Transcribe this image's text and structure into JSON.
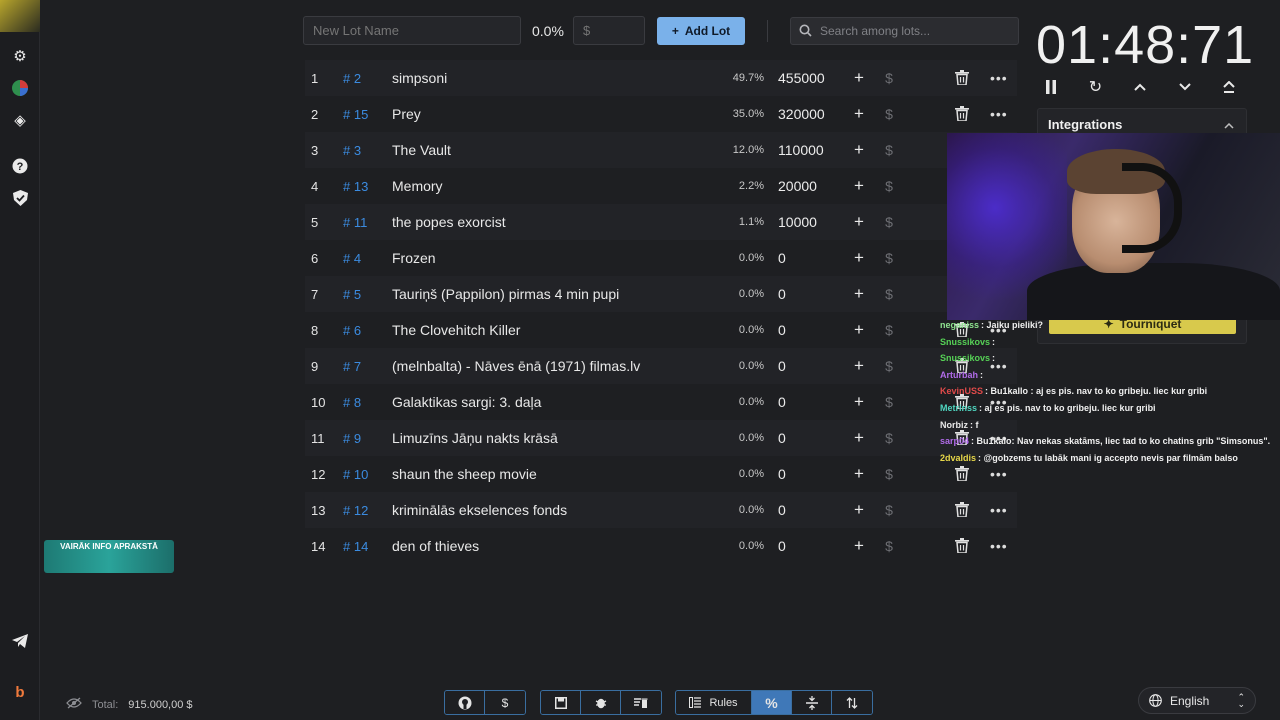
{
  "toolbar": {
    "lot_name_placeholder": "New Lot Name",
    "percent_value": "0.0%",
    "amount_placeholder": "$",
    "add_lot_label": "Add Lot",
    "search_placeholder": "Search among lots..."
  },
  "lots": [
    {
      "index": "1",
      "id": "# 2",
      "name": "simpsoni",
      "percent": "49.7%",
      "amount": "455000"
    },
    {
      "index": "2",
      "id": "# 15",
      "name": "Prey",
      "percent": "35.0%",
      "amount": "320000"
    },
    {
      "index": "3",
      "id": "# 3",
      "name": "The Vault",
      "percent": "12.0%",
      "amount": "110000"
    },
    {
      "index": "4",
      "id": "# 13",
      "name": "Memory",
      "percent": "2.2%",
      "amount": "20000"
    },
    {
      "index": "5",
      "id": "# 11",
      "name": "the popes exorcist",
      "percent": "1.1%",
      "amount": "10000"
    },
    {
      "index": "6",
      "id": "# 4",
      "name": "Frozen",
      "percent": "0.0%",
      "amount": "0"
    },
    {
      "index": "7",
      "id": "# 5",
      "name": "Tauriņš (Pappilon) pirmas 4 min pupi",
      "percent": "0.0%",
      "amount": "0"
    },
    {
      "index": "8",
      "id": "# 6",
      "name": "The Clovehitch Killer",
      "percent": "0.0%",
      "amount": "0"
    },
    {
      "index": "9",
      "id": "# 7",
      "name": "(melnbalta) - Nāves ēnā (1971) filmas.lv",
      "percent": "0.0%",
      "amount": "0"
    },
    {
      "index": "10",
      "id": "# 8",
      "name": "Galaktikas sargi: 3. daļa",
      "percent": "0.0%",
      "amount": "0"
    },
    {
      "index": "11",
      "id": "# 9",
      "name": "Limuzīns Jāņu nakts krāsā",
      "percent": "0.0%",
      "amount": "0"
    },
    {
      "index": "12",
      "id": "# 10",
      "name": "shaun the sheep movie",
      "percent": "0.0%",
      "amount": "0"
    },
    {
      "index": "13",
      "id": "# 12",
      "name": "kriminālās ekselences fonds",
      "percent": "0.0%",
      "amount": "0"
    },
    {
      "index": "14",
      "id": "# 14",
      "name": "den of thieves",
      "percent": "0.0%",
      "amount": "0"
    }
  ],
  "timer": {
    "display": "01:48:71"
  },
  "integrations": {
    "title": "Integrations",
    "tourniquet_label": "Tourniquet"
  },
  "chat": [
    {
      "user": "neganiss",
      "text": ": Jaiku pieliki?",
      "color": "#8fe38f"
    },
    {
      "user": "Snussikovs",
      "text": ":",
      "color": "#56d156"
    },
    {
      "user": "Snussikovs",
      "text": ":",
      "color": "#56d156"
    },
    {
      "user": "Arturbah",
      "text": ":",
      "color": "#b06be8"
    },
    {
      "user": "KevinUSS",
      "text": ": Bu1kallo : aj es pis. nav to ko gribeju. liec kur gribi",
      "color": "#e04a4a"
    },
    {
      "user": "Metrinss",
      "text": ": aj es pis. nav to ko gribeju. liec kur gribi",
      "color": "#4fd6c0"
    },
    {
      "user": "Norbiz",
      "text": ": f",
      "color": "#e8e8e8"
    },
    {
      "user": "sarp04",
      "text": ": Bu1kalo: Nav nekas skatāms, liec tad to ko chatins grib \"Simsonus\".",
      "color": "#b06be8"
    },
    {
      "user": "2dvaldis",
      "text": ": @gobzems tu labāk mani ig accepto nevis par filmām balso",
      "color": "#e8d84a"
    }
  ],
  "promo": {
    "text": "VAIRĀK INFO APRAKSTĀ"
  },
  "footer": {
    "total_label": "Total:",
    "total_value": "915.000,00 $",
    "rules_label": "Rules",
    "percent_symbol": "%",
    "dollar_symbol": "$",
    "language": "English"
  },
  "colors": {
    "accent": "#7ab1ea",
    "id_link": "#3b8be0",
    "background": "#1e1f22"
  }
}
